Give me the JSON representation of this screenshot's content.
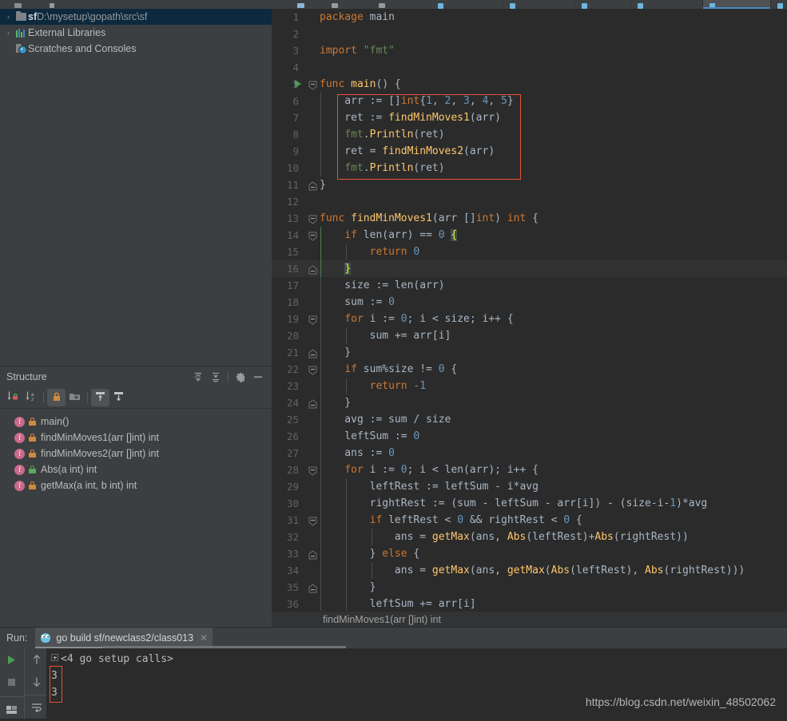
{
  "window": {
    "theme_bg": "#2b2b2b",
    "panel_bg": "#3c3f41",
    "accent": "#4a88c7",
    "selection_bg": "#0d293e",
    "error_box": "#e8503a"
  },
  "tabstrip": {
    "tabs": [
      {
        "name": "tab-1",
        "icon": "go-file-icon",
        "active": false
      },
      {
        "name": "tab-2",
        "icon": "go-file-icon",
        "active": false
      },
      {
        "name": "tab-3",
        "icon": "go-file-icon",
        "active": false
      },
      {
        "name": "tab-4",
        "icon": "go-file-icon",
        "active": false
      },
      {
        "name": "tab-5",
        "icon": "go-file-icon",
        "active": true
      },
      {
        "name": "tab-6",
        "icon": "go-file-icon",
        "active": false
      },
      {
        "name": "tab-7",
        "icon": "go-file-icon",
        "active": false
      },
      {
        "name": "tab-8",
        "icon": "text-file-icon",
        "active": false
      },
      {
        "name": "tab-9",
        "icon": "go-file-icon",
        "active": false
      }
    ]
  },
  "project": {
    "items": [
      {
        "arrow": "›",
        "icon": "folder-icon",
        "prefix": "sf",
        "label": "D:\\mysetup\\gopath\\src\\sf",
        "selected": true
      },
      {
        "arrow": "›",
        "icon": "libraries-icon",
        "prefix": "",
        "label": "External Libraries",
        "selected": false
      },
      {
        "arrow": "",
        "icon": "scratches-icon",
        "prefix": "",
        "label": "Scratches and Consoles",
        "selected": false
      }
    ]
  },
  "structure": {
    "title": "Structure",
    "header_buttons": [
      {
        "name": "expand-all-button",
        "icon": "expand-all-icon"
      },
      {
        "name": "collapse-all-button",
        "icon": "collapse-all-icon"
      },
      {
        "name": "settings-button",
        "icon": "gear-icon"
      },
      {
        "name": "hide-button",
        "icon": "minus-icon"
      }
    ],
    "toolbar_buttons": [
      {
        "name": "sort-by-visibility-button",
        "icon": "sort-visibility-icon",
        "active": false
      },
      {
        "name": "sort-alphabetically-button",
        "icon": "sort-alpha-icon",
        "active": false
      },
      {
        "name": "show-non-public-button",
        "icon": "lock-icon",
        "active": true
      },
      {
        "name": "group-button",
        "icon": "folder-dot-icon",
        "active": false
      },
      {
        "name": "show-inherited-button",
        "icon": "arrow-up-box-icon",
        "active": true
      },
      {
        "name": "show-anonymous-button",
        "icon": "arrow-down-box-icon",
        "active": false
      }
    ],
    "items": [
      {
        "kind": "f",
        "visibility": "private",
        "label": "main()"
      },
      {
        "kind": "f",
        "visibility": "private",
        "label": "findMinMoves1(arr []int) int"
      },
      {
        "kind": "f",
        "visibility": "private",
        "label": "findMinMoves2(arr []int) int"
      },
      {
        "kind": "f",
        "visibility": "public",
        "label": "Abs(a int) int"
      },
      {
        "kind": "f",
        "visibility": "private",
        "label": "getMax(a int, b int) int"
      }
    ]
  },
  "editor": {
    "breadcrumb": "findMinMoves1(arr []int) int",
    "highlight_box": {
      "from_line": 6,
      "to_line": 10
    },
    "current_line": 16,
    "lines": [
      {
        "n": 1,
        "run": false,
        "fold": "",
        "indent": 0,
        "tokens": [
          {
            "t": "package",
            "c": "kw"
          },
          {
            "t": " ",
            "c": "id"
          },
          {
            "t": "main",
            "c": "id"
          }
        ]
      },
      {
        "n": 2,
        "run": false,
        "fold": "",
        "indent": 0,
        "tokens": []
      },
      {
        "n": 3,
        "run": false,
        "fold": "",
        "indent": 0,
        "tokens": [
          {
            "t": "import",
            "c": "kw"
          },
          {
            "t": " ",
            "c": "id"
          },
          {
            "t": "\"fmt\"",
            "c": "str"
          }
        ]
      },
      {
        "n": 4,
        "run": false,
        "fold": "",
        "indent": 0,
        "tokens": []
      },
      {
        "n": 5,
        "run": true,
        "fold": "open",
        "indent": 0,
        "tokens": [
          {
            "t": "func",
            "c": "kw"
          },
          {
            "t": " ",
            "c": "id"
          },
          {
            "t": "main",
            "c": "fn"
          },
          {
            "t": "() {",
            "c": "id"
          }
        ]
      },
      {
        "n": 6,
        "run": false,
        "fold": "",
        "indent": 1,
        "tokens": [
          {
            "t": "    arr := []",
            "c": "id"
          },
          {
            "t": "int",
            "c": "kw"
          },
          {
            "t": "{",
            "c": "id"
          },
          {
            "t": "1",
            "c": "num"
          },
          {
            "t": ", ",
            "c": "id"
          },
          {
            "t": "2",
            "c": "num"
          },
          {
            "t": ", ",
            "c": "id"
          },
          {
            "t": "3",
            "c": "num"
          },
          {
            "t": ", ",
            "c": "id"
          },
          {
            "t": "4",
            "c": "num"
          },
          {
            "t": ", ",
            "c": "id"
          },
          {
            "t": "5",
            "c": "num"
          },
          {
            "t": "}",
            "c": "id"
          }
        ]
      },
      {
        "n": 7,
        "run": false,
        "fold": "",
        "indent": 1,
        "tokens": [
          {
            "t": "    ret := ",
            "c": "id"
          },
          {
            "t": "findMinMoves1",
            "c": "fn"
          },
          {
            "t": "(arr)",
            "c": "id"
          }
        ]
      },
      {
        "n": 8,
        "run": false,
        "fold": "",
        "indent": 1,
        "tokens": [
          {
            "t": "    ",
            "c": "id"
          },
          {
            "t": "fmt",
            "c": "green"
          },
          {
            "t": ".",
            "c": "id"
          },
          {
            "t": "Println",
            "c": "fn"
          },
          {
            "t": "(ret)",
            "c": "id"
          }
        ]
      },
      {
        "n": 9,
        "run": false,
        "fold": "",
        "indent": 1,
        "tokens": [
          {
            "t": "    ret = ",
            "c": "id"
          },
          {
            "t": "findMinMoves2",
            "c": "fn"
          },
          {
            "t": "(arr)",
            "c": "id"
          }
        ]
      },
      {
        "n": 10,
        "run": false,
        "fold": "",
        "indent": 1,
        "tokens": [
          {
            "t": "    ",
            "c": "id"
          },
          {
            "t": "fmt",
            "c": "green"
          },
          {
            "t": ".",
            "c": "id"
          },
          {
            "t": "Println",
            "c": "fn"
          },
          {
            "t": "(ret)",
            "c": "id"
          }
        ]
      },
      {
        "n": 11,
        "run": false,
        "fold": "close",
        "indent": 0,
        "tokens": [
          {
            "t": "}",
            "c": "id"
          }
        ]
      },
      {
        "n": 12,
        "run": false,
        "fold": "",
        "indent": 0,
        "tokens": []
      },
      {
        "n": 13,
        "run": false,
        "fold": "open",
        "indent": 0,
        "tokens": [
          {
            "t": "func",
            "c": "kw"
          },
          {
            "t": " ",
            "c": "id"
          },
          {
            "t": "findMinMoves1",
            "c": "fn"
          },
          {
            "t": "(arr []",
            "c": "id"
          },
          {
            "t": "int",
            "c": "kw"
          },
          {
            "t": ") ",
            "c": "id"
          },
          {
            "t": "int",
            "c": "kw"
          },
          {
            "t": " {",
            "c": "id"
          }
        ]
      },
      {
        "n": 14,
        "run": false,
        "fold": "open2",
        "indent": 1,
        "tokens": [
          {
            "t": "    ",
            "c": "id"
          },
          {
            "t": "if",
            "c": "kw"
          },
          {
            "t": " ",
            "c": "id"
          },
          {
            "t": "len",
            "c": "id"
          },
          {
            "t": "(arr) == ",
            "c": "id"
          },
          {
            "t": "0",
            "c": "num"
          },
          {
            "t": " ",
            "c": "id"
          },
          {
            "t": "{",
            "c": "brace-hl"
          }
        ]
      },
      {
        "n": 15,
        "run": false,
        "fold": "",
        "indent": 2,
        "tokens": [
          {
            "t": "        ",
            "c": "id"
          },
          {
            "t": "return",
            "c": "kw"
          },
          {
            "t": " ",
            "c": "id"
          },
          {
            "t": "0",
            "c": "num"
          }
        ]
      },
      {
        "n": 16,
        "run": false,
        "fold": "close2",
        "indent": 1,
        "tokens": [
          {
            "t": "    ",
            "c": "id"
          },
          {
            "t": "}",
            "c": "brace-hl"
          }
        ]
      },
      {
        "n": 17,
        "run": false,
        "fold": "",
        "indent": 1,
        "tokens": [
          {
            "t": "    size := ",
            "c": "id"
          },
          {
            "t": "len",
            "c": "id"
          },
          {
            "t": "(arr)",
            "c": "id"
          }
        ]
      },
      {
        "n": 18,
        "run": false,
        "fold": "",
        "indent": 1,
        "tokens": [
          {
            "t": "    sum := ",
            "c": "id"
          },
          {
            "t": "0",
            "c": "num"
          }
        ]
      },
      {
        "n": 19,
        "run": false,
        "fold": "open2",
        "indent": 1,
        "tokens": [
          {
            "t": "    ",
            "c": "id"
          },
          {
            "t": "for",
            "c": "kw"
          },
          {
            "t": " i := ",
            "c": "id"
          },
          {
            "t": "0",
            "c": "num"
          },
          {
            "t": "; i < size; i++ {",
            "c": "id"
          }
        ]
      },
      {
        "n": 20,
        "run": false,
        "fold": "",
        "indent": 2,
        "tokens": [
          {
            "t": "        sum += arr[i]",
            "c": "id"
          }
        ]
      },
      {
        "n": 21,
        "run": false,
        "fold": "close2",
        "indent": 1,
        "tokens": [
          {
            "t": "    }",
            "c": "id"
          }
        ]
      },
      {
        "n": 22,
        "run": false,
        "fold": "open2",
        "indent": 1,
        "tokens": [
          {
            "t": "    ",
            "c": "id"
          },
          {
            "t": "if",
            "c": "kw"
          },
          {
            "t": " sum%size != ",
            "c": "id"
          },
          {
            "t": "0",
            "c": "num"
          },
          {
            "t": " {",
            "c": "id"
          }
        ]
      },
      {
        "n": 23,
        "run": false,
        "fold": "",
        "indent": 2,
        "tokens": [
          {
            "t": "        ",
            "c": "id"
          },
          {
            "t": "return",
            "c": "kw"
          },
          {
            "t": " ",
            "c": "id"
          },
          {
            "t": "-1",
            "c": "num"
          }
        ]
      },
      {
        "n": 24,
        "run": false,
        "fold": "close2",
        "indent": 1,
        "tokens": [
          {
            "t": "    }",
            "c": "id"
          }
        ]
      },
      {
        "n": 25,
        "run": false,
        "fold": "",
        "indent": 1,
        "tokens": [
          {
            "t": "    avg := sum / size",
            "c": "id"
          }
        ]
      },
      {
        "n": 26,
        "run": false,
        "fold": "",
        "indent": 1,
        "tokens": [
          {
            "t": "    leftSum := ",
            "c": "id"
          },
          {
            "t": "0",
            "c": "num"
          }
        ]
      },
      {
        "n": 27,
        "run": false,
        "fold": "",
        "indent": 1,
        "tokens": [
          {
            "t": "    ans := ",
            "c": "id"
          },
          {
            "t": "0",
            "c": "num"
          }
        ]
      },
      {
        "n": 28,
        "run": false,
        "fold": "open2",
        "indent": 1,
        "tokens": [
          {
            "t": "    ",
            "c": "id"
          },
          {
            "t": "for",
            "c": "kw"
          },
          {
            "t": " i := ",
            "c": "id"
          },
          {
            "t": "0",
            "c": "num"
          },
          {
            "t": "; i < ",
            "c": "id"
          },
          {
            "t": "len",
            "c": "id"
          },
          {
            "t": "(arr); i++ {",
            "c": "id"
          }
        ]
      },
      {
        "n": 29,
        "run": false,
        "fold": "",
        "indent": 2,
        "tokens": [
          {
            "t": "        leftRest := leftSum - i*avg",
            "c": "id"
          }
        ]
      },
      {
        "n": 30,
        "run": false,
        "fold": "",
        "indent": 2,
        "tokens": [
          {
            "t": "        rightRest := (sum - leftSum - arr[i]) - (size-i-",
            "c": "id"
          },
          {
            "t": "1",
            "c": "num"
          },
          {
            "t": ")*avg",
            "c": "id"
          }
        ]
      },
      {
        "n": 31,
        "run": false,
        "fold": "open3",
        "indent": 2,
        "tokens": [
          {
            "t": "        ",
            "c": "id"
          },
          {
            "t": "if",
            "c": "kw"
          },
          {
            "t": " leftRest < ",
            "c": "id"
          },
          {
            "t": "0",
            "c": "num"
          },
          {
            "t": " && rightRest < ",
            "c": "id"
          },
          {
            "t": "0",
            "c": "num"
          },
          {
            "t": " {",
            "c": "id"
          }
        ]
      },
      {
        "n": 32,
        "run": false,
        "fold": "",
        "indent": 3,
        "tokens": [
          {
            "t": "            ans = ",
            "c": "id"
          },
          {
            "t": "getMax",
            "c": "fn"
          },
          {
            "t": "(ans, ",
            "c": "id"
          },
          {
            "t": "Abs",
            "c": "fn"
          },
          {
            "t": "(leftRest)+",
            "c": "id"
          },
          {
            "t": "Abs",
            "c": "fn"
          },
          {
            "t": "(rightRest))",
            "c": "id"
          }
        ]
      },
      {
        "n": 33,
        "run": false,
        "fold": "close3",
        "indent": 2,
        "tokens": [
          {
            "t": "        } ",
            "c": "id"
          },
          {
            "t": "else",
            "c": "kw"
          },
          {
            "t": " {",
            "c": "id"
          }
        ]
      },
      {
        "n": 34,
        "run": false,
        "fold": "",
        "indent": 3,
        "tokens": [
          {
            "t": "            ans = ",
            "c": "id"
          },
          {
            "t": "getMax",
            "c": "fn"
          },
          {
            "t": "(ans, ",
            "c": "id"
          },
          {
            "t": "getMax",
            "c": "fn"
          },
          {
            "t": "(",
            "c": "id"
          },
          {
            "t": "Abs",
            "c": "fn"
          },
          {
            "t": "(leftRest), ",
            "c": "id"
          },
          {
            "t": "Abs",
            "c": "fn"
          },
          {
            "t": "(rightRest)))",
            "c": "id"
          }
        ]
      },
      {
        "n": 35,
        "run": false,
        "fold": "close3",
        "indent": 2,
        "tokens": [
          {
            "t": "        }",
            "c": "id"
          }
        ]
      },
      {
        "n": 36,
        "run": false,
        "fold": "",
        "indent": 2,
        "tokens": [
          {
            "t": "        leftSum += arr[i]",
            "c": "id"
          }
        ]
      }
    ]
  },
  "run_panel": {
    "label": "Run:",
    "tab_title": "go build sf/newclass2/class013",
    "tab_icon": "go-gopher-icon",
    "close_icon": "close-icon",
    "side_buttons": [
      {
        "name": "rerun-button",
        "icon": "play-icon"
      },
      {
        "name": "stop-button",
        "icon": "stop-icon"
      },
      {
        "name": "layout-button",
        "icon": "layout-icon"
      }
    ],
    "side_buttons2": [
      {
        "name": "prev-occurrence-button",
        "icon": "arrow-up-icon"
      },
      {
        "name": "next-occurrence-button",
        "icon": "arrow-down-icon"
      },
      {
        "name": "soft-wrap-button",
        "icon": "soft-wrap-icon"
      }
    ],
    "console_lines": [
      {
        "text": "<4 go setup calls>",
        "folded": true
      },
      {
        "text": "3",
        "folded": false
      },
      {
        "text": "3",
        "folded": false
      }
    ],
    "output_highlight": {
      "from": 1,
      "to": 2
    }
  },
  "watermark": "https://blog.csdn.net/weixin_48502062"
}
